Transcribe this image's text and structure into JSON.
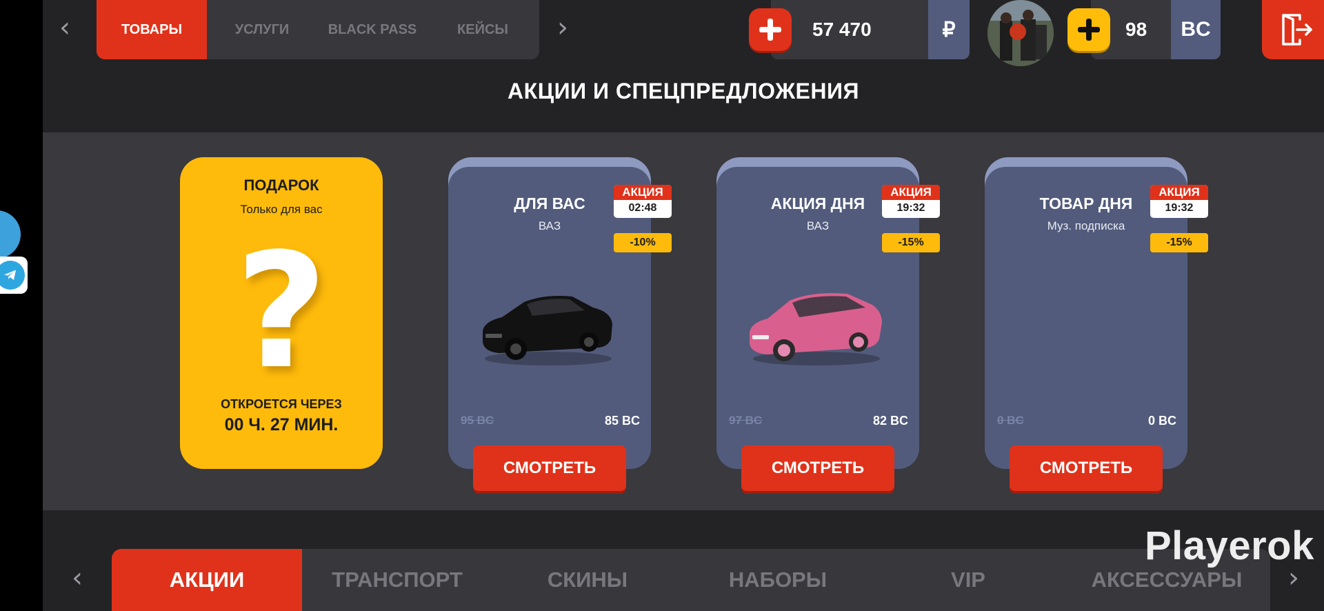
{
  "top_tabs": [
    {
      "label": "ТОВАРЫ",
      "active": true
    },
    {
      "label": "УСЛУГИ",
      "active": false
    },
    {
      "label": "BLACK PASS",
      "active": false
    },
    {
      "label": "КЕЙСЫ",
      "active": false
    }
  ],
  "balance_rub": {
    "amount": "57 470",
    "unit": "₽"
  },
  "balance_bc": {
    "amount": "98",
    "unit": "BC"
  },
  "section_title": "АКЦИИ И СПЕЦПРЕДЛОЖЕНИЯ",
  "gift": {
    "title": "ПОДАРОК",
    "subtitle": "Только для вас",
    "symbol": "?",
    "opens_label": "ОТКРОЕТСЯ ЧЕРЕЗ",
    "timer": "00 Ч. 27 МИН."
  },
  "cards": [
    {
      "name": "ДЛЯ ВАС",
      "model": "ВАЗ",
      "badge": "АКЦИЯ",
      "timer": "02:48",
      "discount": "-10%",
      "old_price": "95 BC",
      "new_price": "85 BC",
      "button": "СМОТРЕТЬ",
      "car_color": "#111111"
    },
    {
      "name": "АКЦИЯ ДНЯ",
      "model": "ВАЗ",
      "badge": "АКЦИЯ",
      "timer": "19:32",
      "discount": "-15%",
      "old_price": "97 BC",
      "new_price": "82 BC",
      "button": "СМОТРЕТЬ",
      "car_color": "#d9608e"
    },
    {
      "name": "ТОВАР ДНЯ",
      "model": "Муз. подписка",
      "badge": "АКЦИЯ",
      "timer": "19:32",
      "discount": "-15%",
      "old_price": "0 BC",
      "new_price": "0 BC",
      "button": "СМОТРЕТЬ",
      "car_color": ""
    }
  ],
  "bottom_tabs": [
    {
      "label": "АКЦИИ",
      "active": true
    },
    {
      "label": "ТРАНСПОРТ",
      "active": false
    },
    {
      "label": "СКИНЫ",
      "active": false
    },
    {
      "label": "НАБОРЫ",
      "active": false
    },
    {
      "label": "VIP",
      "active": false
    },
    {
      "label": "АКСЕССУАРЫ",
      "active": false
    }
  ],
  "watermark": "Playerok",
  "colors": {
    "accent_red": "#e0321a",
    "accent_yellow": "#ffbb0b",
    "card_blue": "#525b7b",
    "panel": "#38383c"
  }
}
